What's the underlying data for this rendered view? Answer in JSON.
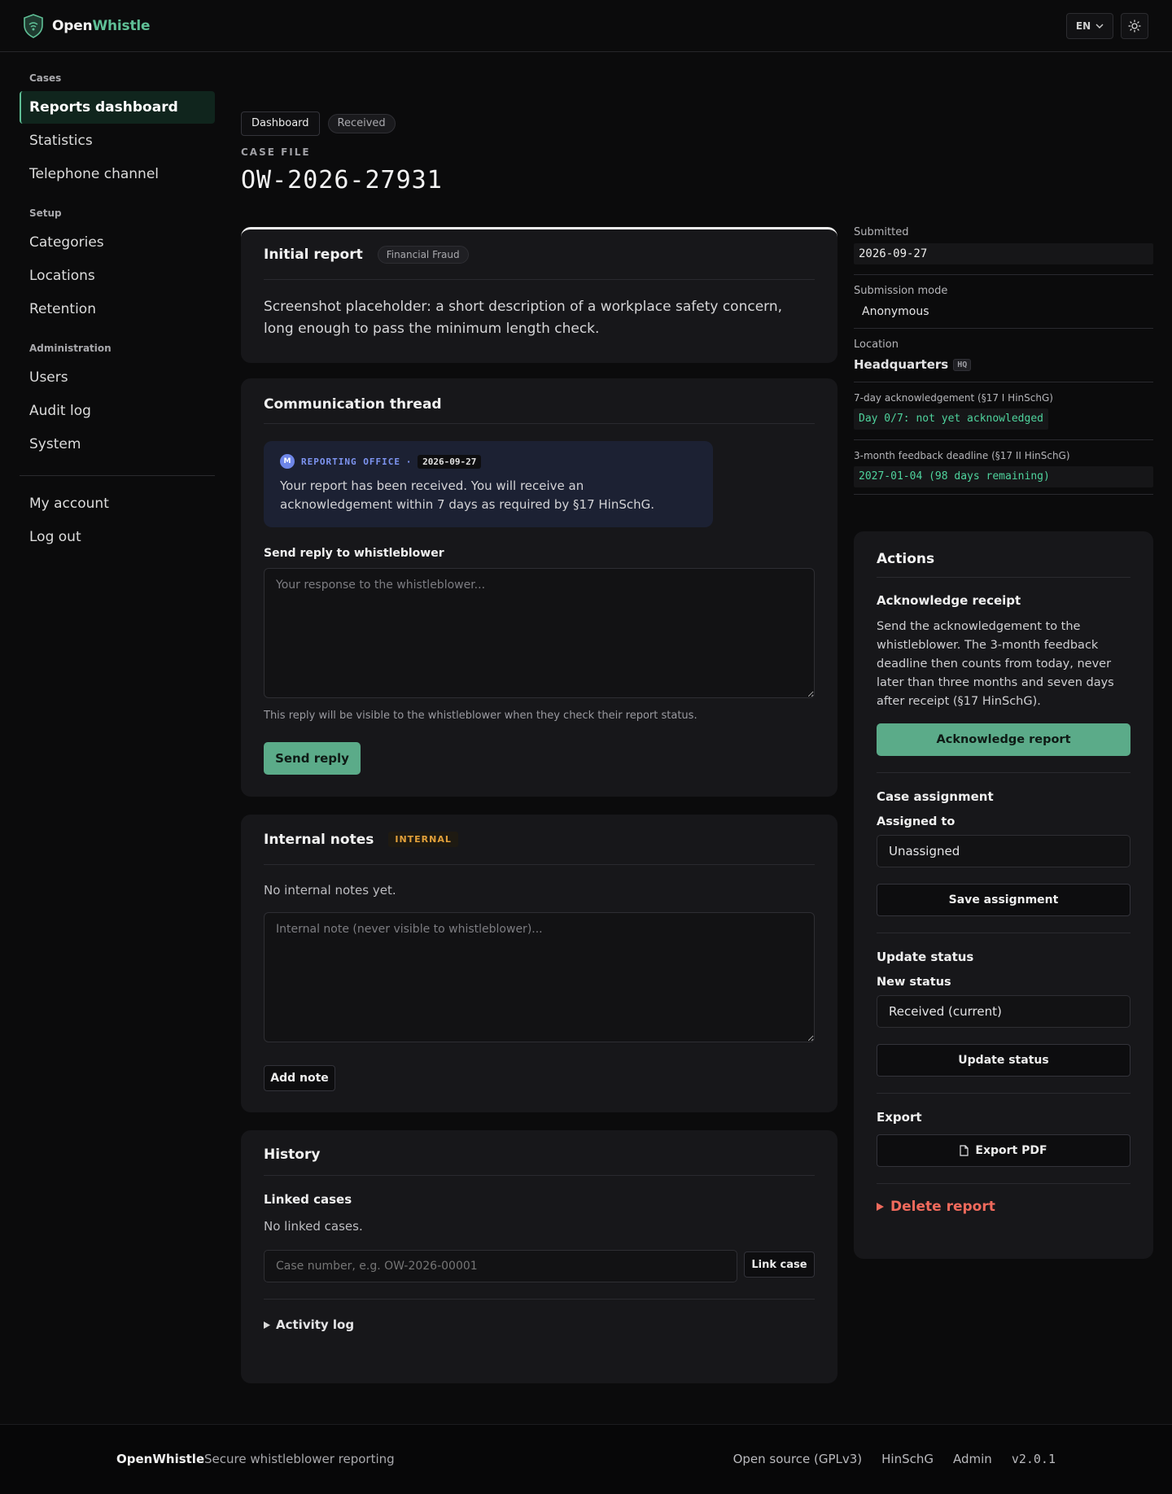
{
  "app": {
    "name_part1": "Open",
    "name_part2": "Whistle",
    "lang": "EN"
  },
  "colors": {
    "accent": "#5fbf96",
    "primary_button": "#5bab89",
    "danger": "#f06a5c",
    "internal_badge": "#e2a03a",
    "deadline_green": "#4fd39d"
  },
  "sidebar": {
    "groups": [
      {
        "label": "Cases",
        "items": [
          "Reports dashboard",
          "Statistics",
          "Telephone channel"
        ]
      },
      {
        "label": "Setup",
        "items": [
          "Categories",
          "Locations",
          "Retention"
        ]
      },
      {
        "label": "Administration",
        "items": [
          "Users",
          "Audit log",
          "System"
        ]
      }
    ],
    "bottom": [
      "My account",
      "Log out"
    ],
    "active": "Reports dashboard"
  },
  "header": {
    "crumb_button": "Dashboard",
    "status_badge": "Received",
    "case_label": "CASE FILE",
    "case_id": "OW-2026-27931"
  },
  "initial_report": {
    "title": "Initial report",
    "category": "Financial Fraud",
    "text": "Screenshot placeholder: a short description of a workplace safety concern, long enough to pass the minimum length check."
  },
  "thread": {
    "title": "Communication thread",
    "message": {
      "avatar": "M",
      "sender": "REPORTING OFFICE",
      "separator": "·",
      "date": "2026-09-27",
      "text": "Your report has been received. You will receive an acknowledgement within 7 days as required by §17 HinSchG."
    },
    "reply_label": "Send reply to whistleblower",
    "reply_placeholder": "Your response to the whistleblower...",
    "reply_hint": "This reply will be visible to the whistleblower when they check their report status.",
    "send_button": "Send reply"
  },
  "notes": {
    "title": "Internal notes",
    "badge": "INTERNAL",
    "empty": "No internal notes yet.",
    "placeholder": "Internal note (never visible to whistleblower)...",
    "add_button": "Add note"
  },
  "history": {
    "title": "History",
    "linked_label": "Linked cases",
    "linked_empty": "No linked cases.",
    "link_placeholder": "Case number, e.g. OW-2026-00001",
    "link_button": "Link case",
    "activity_log": "Activity log"
  },
  "meta": {
    "submitted_label": "Submitted",
    "submitted_value": "2026-09-27",
    "mode_label": "Submission mode",
    "mode_value": "Anonymous",
    "location_label": "Location",
    "location_value": "Headquarters",
    "location_code": "HQ",
    "ack_label": "7-day acknowledgement (§17 I HinSchG)",
    "ack_value": "Day 0/7: not yet acknowledged",
    "feedback_label": "3-month feedback deadline (§17 II HinSchG)",
    "feedback_value": "2027-01-04 (98 days remaining)"
  },
  "actions": {
    "title": "Actions",
    "ack_title": "Acknowledge receipt",
    "ack_text": "Send the acknowledgement to the whistleblower. The 3-month feedback deadline then counts from today, never later than three months and seven days after receipt (§17 HinSchG).",
    "ack_button": "Acknowledge report",
    "assign_title": "Case assignment",
    "assigned_label": "Assigned to",
    "assigned_value": "Unassigned",
    "save_assignment": "Save assignment",
    "status_title": "Update status",
    "new_status_label": "New status",
    "new_status_value": "Received (current)",
    "update_status": "Update status",
    "export_title": "Export",
    "export_pdf": "Export PDF",
    "delete": "Delete report"
  },
  "footer": {
    "brand": "OpenWhistle",
    "tagline": "Secure whistleblower reporting",
    "links": [
      "Open source (GPLv3)",
      "HinSchG",
      "Admin"
    ],
    "version": "v2.0.1"
  }
}
